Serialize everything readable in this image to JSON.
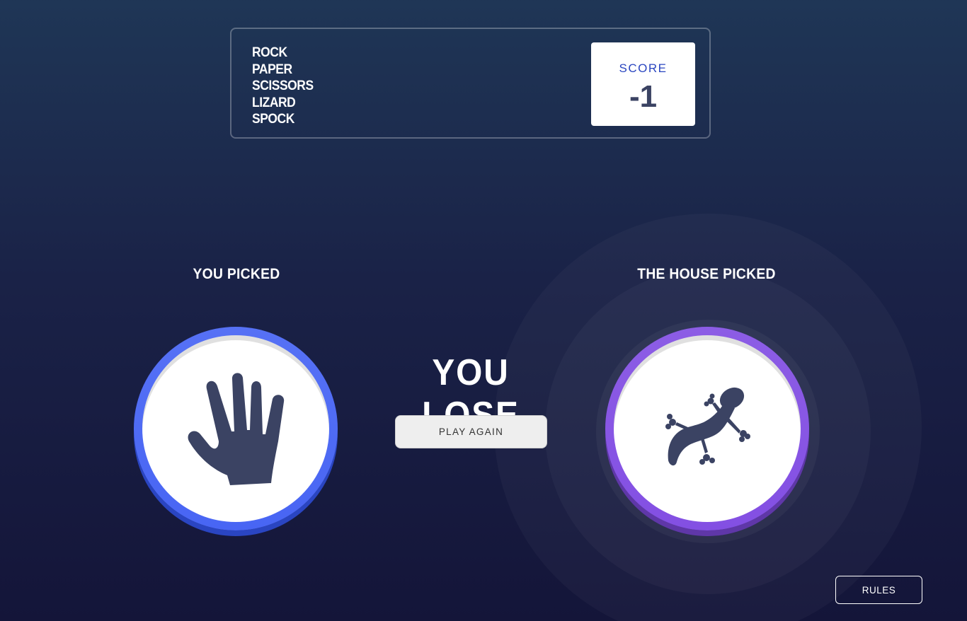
{
  "header": {
    "title_words": [
      "ROCK",
      "PAPER",
      "SCISSORS",
      "LIZARD",
      "SPOCK"
    ],
    "score_label": "SCORE",
    "score_value": "-1"
  },
  "game": {
    "you_picked_label": "YOU PICKED",
    "house_picked_label": "THE HOUSE PICKED",
    "player_choice": "paper",
    "house_choice": "lizard",
    "result_text": "YOU LOSE",
    "play_again_label": "PLAY AGAIN"
  },
  "footer": {
    "rules_label": "RULES"
  },
  "colors": {
    "paper": "#4865f4",
    "lizard": "#834fe3",
    "icon": "#3b4363",
    "score_label": "#2a46c0"
  },
  "icons": {
    "player": "hand-paper-icon",
    "house": "lizard-icon"
  }
}
